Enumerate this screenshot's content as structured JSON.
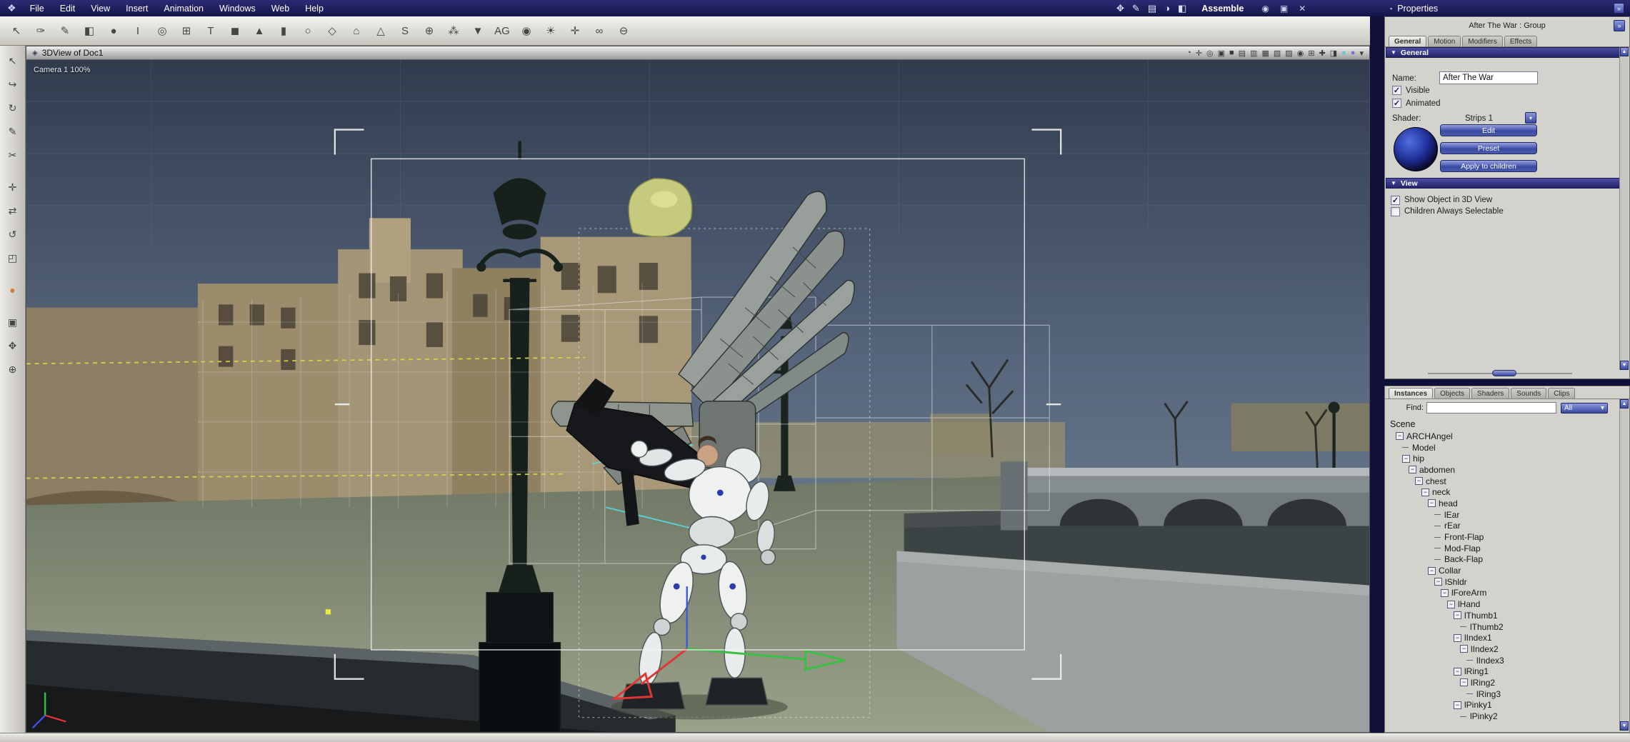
{
  "menubar": {
    "logo_glyph": "❖",
    "items": [
      "File",
      "Edit",
      "View",
      "Insert",
      "Animation",
      "Windows",
      "Web",
      "Help"
    ],
    "room_icons": [
      {
        "name": "assemble-room-icon",
        "glyph": "✥"
      },
      {
        "name": "model-room-icon",
        "glyph": "✎"
      },
      {
        "name": "storyboard-room-icon",
        "glyph": "▤"
      },
      {
        "name": "texture-room-icon",
        "glyph": "◑"
      },
      {
        "name": "render-room-icon",
        "glyph": "◧"
      }
    ],
    "room_label": "Assemble",
    "window_icons": [
      {
        "name": "eye-icon",
        "glyph": "◉"
      },
      {
        "name": "restore-window-icon",
        "glyph": "▣"
      },
      {
        "name": "close-window-icon",
        "glyph": "✕"
      }
    ]
  },
  "toolbar": {
    "icons": [
      {
        "name": "select-arrow-icon",
        "glyph": "↖"
      },
      {
        "name": "hand-tool-icon",
        "glyph": "✑"
      },
      {
        "name": "brush-tool-icon",
        "glyph": "✎"
      },
      {
        "name": "bucket-tool-icon",
        "glyph": "◧"
      },
      {
        "name": "sphere-primitive-icon",
        "glyph": "●"
      },
      {
        "name": "ibeam-tool-icon",
        "glyph": "I"
      },
      {
        "name": "swirl-tool-icon",
        "glyph": "◎"
      },
      {
        "name": "duplicate-icon",
        "glyph": "⊞"
      },
      {
        "name": "text-primitive-icon",
        "glyph": "T"
      },
      {
        "name": "cube-primitive-icon",
        "glyph": "◼"
      },
      {
        "name": "cone-primitive-icon",
        "glyph": "▲"
      },
      {
        "name": "cylinder-primitive-icon",
        "glyph": "▮"
      },
      {
        "name": "torus-primitive-icon",
        "glyph": "○"
      },
      {
        "name": "plane-primitive-icon",
        "glyph": "◇"
      },
      {
        "name": "infinite-plane-icon",
        "glyph": "⌂"
      },
      {
        "name": "vertex-object-icon",
        "glyph": "△"
      },
      {
        "name": "spline-object-icon",
        "glyph": "S"
      },
      {
        "name": "metaball-object-icon",
        "glyph": "⊕"
      },
      {
        "name": "particle-emitter-icon",
        "glyph": "⁂"
      },
      {
        "name": "spotlight-icon",
        "glyph": "▼"
      },
      {
        "name": "agl-icon",
        "glyph": "AG"
      },
      {
        "name": "camera-icon",
        "glyph": "◉"
      },
      {
        "name": "light-icon",
        "glyph": "☀"
      },
      {
        "name": "target-helper-icon",
        "glyph": "✛"
      },
      {
        "name": "link-modifier-icon",
        "glyph": "∞"
      },
      {
        "name": "boolean-icon",
        "glyph": "⊖"
      }
    ]
  },
  "left_toolbar": {
    "icons": [
      {
        "name": "select-tool-icon",
        "glyph": "↖"
      },
      {
        "name": "direct-manipulation-icon",
        "glyph": "↪"
      },
      {
        "name": "rotate-view-icon",
        "glyph": "↻"
      },
      {
        "name": "pen-tool-icon",
        "glyph": "✎"
      },
      {
        "name": "knife-tool-icon",
        "glyph": "✂"
      },
      {
        "name": "move-tool-icon",
        "glyph": "✛",
        "gap": true
      },
      {
        "name": "translate-tool-icon",
        "glyph": "⇄"
      },
      {
        "name": "rotate-object-icon",
        "glyph": "↺"
      },
      {
        "name": "scale-object-icon",
        "glyph": "◰"
      },
      {
        "name": "hotpoint-tool-icon",
        "glyph": "●",
        "tint": "#d08030",
        "gap": true
      },
      {
        "name": "reference-box-icon",
        "glyph": "▣",
        "gap": true
      },
      {
        "name": "pan-view-icon",
        "glyph": "✥"
      },
      {
        "name": "zoom-view-icon",
        "glyph": "⊕"
      }
    ]
  },
  "viewport": {
    "title": "3DView of Doc1",
    "title_glyph": "◈",
    "camera_label": "Camera 1 100%",
    "header_icons": [
      {
        "name": "preview-quality-icon",
        "glyph": "◔"
      },
      {
        "name": "track-xy-icon",
        "glyph": "✛"
      },
      {
        "name": "aim-camera-icon",
        "glyph": "◎"
      },
      {
        "name": "frame-selection-icon",
        "glyph": "▣"
      },
      {
        "name": "layout-single-icon",
        "glyph": "■"
      },
      {
        "name": "layout-two-vert-icon",
        "glyph": "▤"
      },
      {
        "name": "layout-two-horiz-icon",
        "glyph": "▥"
      },
      {
        "name": "layout-four-icon",
        "glyph": "▦"
      },
      {
        "name": "layout-three-icon",
        "glyph": "▧"
      },
      {
        "name": "ghost-menu-icon",
        "glyph": "▨"
      },
      {
        "name": "camera-list-icon",
        "glyph": "◉"
      },
      {
        "name": "grid-toggle-icon",
        "glyph": "⊞"
      },
      {
        "name": "axis-toggle-icon",
        "glyph": "✚"
      },
      {
        "name": "backdrop-icon",
        "glyph": "◨"
      },
      {
        "name": "wireframe-color-icon",
        "glyph": "●",
        "tint": "#5ac8d8"
      },
      {
        "name": "background-color-icon",
        "glyph": "●",
        "tint": "#8a6ad0"
      },
      {
        "name": "pane-menu-icon",
        "glyph": "▾"
      }
    ]
  },
  "properties": {
    "title": "Properties",
    "header_glyph": "▪",
    "dock_glyph": "»",
    "undock_glyph": "»",
    "subtitle": "After The War : Group",
    "collapse_glyph": "▼",
    "dd_glyph": "▾",
    "tabs": [
      {
        "name": "tab-general",
        "label": "General",
        "active": true
      },
      {
        "name": "tab-motion",
        "label": "Motion"
      },
      {
        "name": "tab-modifiers",
        "label": "Modifiers"
      },
      {
        "name": "tab-effects",
        "label": "Effects"
      }
    ],
    "general_section": "General",
    "name_label": "Name:",
    "name_value": "After The War",
    "visible_label": "Visible",
    "visible_checked": true,
    "animated_label": "Animated",
    "animated_checked": true,
    "shader_label": "Shader:",
    "shader_value": "Strips 1",
    "buttons": [
      {
        "name": "edit-button",
        "label": "Edit"
      },
      {
        "name": "preset-button",
        "label": "Preset"
      },
      {
        "name": "apply-children-button",
        "label": "Apply to children"
      }
    ],
    "view_section": "View",
    "view_options": [
      {
        "label": "Show Object in 3D View",
        "checked": true
      },
      {
        "label": "Children Always Selectable",
        "checked": false
      }
    ]
  },
  "instances": {
    "dd_glyph": "▾",
    "tabs": [
      {
        "name": "tab-instances",
        "label": "Instances",
        "active": true
      },
      {
        "name": "tab-objects",
        "label": "Objects"
      },
      {
        "name": "tab-shaders",
        "label": "Shaders"
      },
      {
        "name": "tab-sounds",
        "label": "Sounds"
      },
      {
        "name": "tab-clips",
        "label": "Clips"
      }
    ],
    "find_label": "Find:",
    "find_value": "",
    "filter_value": "All",
    "scene_label": "Scene",
    "tree": [
      {
        "label": "ARCHAngel",
        "depth": 1,
        "box": true
      },
      {
        "label": "Model",
        "depth": 2
      },
      {
        "label": "hip",
        "depth": 2,
        "box": true
      },
      {
        "label": "abdomen",
        "depth": 3,
        "box": true
      },
      {
        "label": "chest",
        "depth": 4,
        "box": true
      },
      {
        "label": "neck",
        "depth": 5,
        "box": true
      },
      {
        "label": "head",
        "depth": 6,
        "box": true
      },
      {
        "label": "lEar",
        "depth": 7
      },
      {
        "label": "rEar",
        "depth": 7
      },
      {
        "label": "Front-Flap",
        "depth": 7
      },
      {
        "label": "Mod-Flap",
        "depth": 7
      },
      {
        "label": "Back-Flap",
        "depth": 7
      },
      {
        "label": "Collar",
        "depth": 6,
        "box": true
      },
      {
        "label": "lShldr",
        "depth": 7,
        "box": true
      },
      {
        "label": "lForeArm",
        "depth": 8,
        "box": true
      },
      {
        "label": "lHand",
        "depth": 9,
        "box": true
      },
      {
        "label": "lThumb1",
        "depth": 10,
        "box": true
      },
      {
        "label": "lThumb2",
        "depth": 11
      },
      {
        "label": "lIndex1",
        "depth": 10,
        "box": true
      },
      {
        "label": "lIndex2",
        "depth": 11,
        "box": true
      },
      {
        "label": "lIndex3",
        "depth": 12
      },
      {
        "label": "lRing1",
        "depth": 10,
        "box": true
      },
      {
        "label": "lRing2",
        "depth": 11,
        "box": true
      },
      {
        "label": "lRing3",
        "depth": 12
      },
      {
        "label": "lPinky1",
        "depth": 10,
        "box": true
      },
      {
        "label": "lPinky2",
        "depth": 11
      }
    ]
  }
}
